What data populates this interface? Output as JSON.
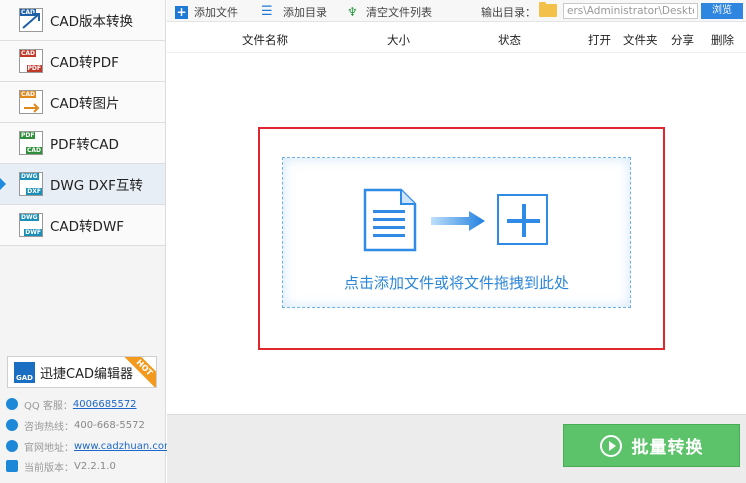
{
  "sidebar": {
    "items": [
      {
        "label": "CAD版本转换",
        "icon": "cad-version-icon",
        "icon_tag": "CAD",
        "icon_tag2": "",
        "active": false
      },
      {
        "label": "CAD转PDF",
        "icon": "cad-to-pdf-icon",
        "icon_tag": "CAD",
        "icon_tag2": "PDF",
        "active": false
      },
      {
        "label": "CAD转图片",
        "icon": "cad-to-image-icon",
        "icon_tag": "CAD",
        "icon_tag2": "",
        "active": false
      },
      {
        "label": "PDF转CAD",
        "icon": "pdf-to-cad-icon",
        "icon_tag": "PDF",
        "icon_tag2": "CAD",
        "active": false
      },
      {
        "label": "DWG DXF互转",
        "icon": "dwg-dxf-icon",
        "icon_tag": "DWG",
        "icon_tag2": "DXF",
        "active": true
      },
      {
        "label": "CAD转DWF",
        "icon": "cad-to-dwf-icon",
        "icon_tag": "DWG",
        "icon_tag2": "DWF",
        "active": false
      }
    ],
    "editor_button": {
      "label": "迅捷CAD编辑器",
      "icon_text": "GAD",
      "badge": "HOT"
    },
    "info": {
      "qq_label": "QQ 客服：",
      "qq_value": "4006685572",
      "hotline_label": "咨询热线：",
      "hotline_value": "400-668-5572",
      "website_label": "官网地址：",
      "website_value": "www.cadzhuan.com",
      "version_label": "当前版本：",
      "version_value": "V2.2.1.0"
    }
  },
  "toolbar": {
    "add_file": "添加文件",
    "add_dir": "添加目录",
    "clear_list": "清空文件列表",
    "output_label": "输出目录：",
    "output_path": "ers\\Administrator\\Desktop",
    "browse": "浏览"
  },
  "columns": {
    "name": "文件名称",
    "size": "大小",
    "status": "状态",
    "open": "打开",
    "folder": "文件夹",
    "share": "分享",
    "delete": "删除"
  },
  "drop_zone": {
    "hint": "点击添加文件或将文件拖拽到此处"
  },
  "actions": {
    "batch_convert": "批量转换"
  },
  "colors": {
    "accent_blue": "#2f86e0",
    "highlight_red": "#e0262e",
    "convert_green": "#5cc36a"
  }
}
